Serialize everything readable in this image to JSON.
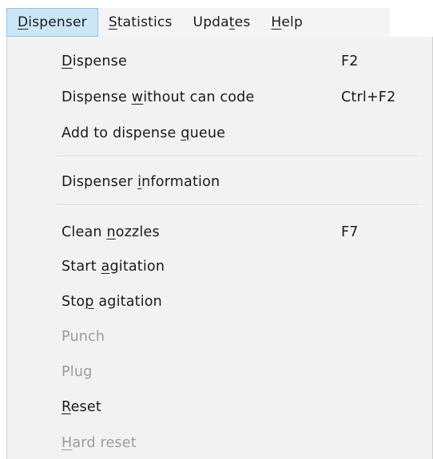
{
  "menubar": {
    "items": [
      {
        "pre": "",
        "mnem": "D",
        "post": "ispenser",
        "active": true
      },
      {
        "pre": "",
        "mnem": "S",
        "post": "tatistics",
        "active": false
      },
      {
        "pre": "Upda",
        "mnem": "t",
        "post": "es",
        "active": false
      },
      {
        "pre": "",
        "mnem": "H",
        "post": "elp",
        "active": false
      }
    ]
  },
  "dropdown": {
    "items": [
      {
        "pre": "",
        "mnem": "D",
        "post": "ispense",
        "shortcut": "F2",
        "disabled": false
      },
      {
        "pre": "Dispense ",
        "mnem": "w",
        "post": "ithout can code",
        "shortcut": "Ctrl+F2",
        "disabled": false
      },
      {
        "pre": "Add to dispense ",
        "mnem": "q",
        "post": "ueue",
        "shortcut": "",
        "disabled": false
      },
      {
        "pre": "Dispenser ",
        "mnem": "i",
        "post": "nformation",
        "shortcut": "",
        "disabled": false
      },
      {
        "pre": "Clean ",
        "mnem": "n",
        "post": "ozzles",
        "shortcut": "F7",
        "disabled": false
      },
      {
        "pre": "Start ",
        "mnem": "a",
        "post": "gitation",
        "shortcut": "",
        "disabled": false
      },
      {
        "pre": "Sto",
        "mnem": "p",
        "post": " agitation",
        "shortcut": "",
        "disabled": false
      },
      {
        "pre": "Punch",
        "mnem": "",
        "post": "",
        "shortcut": "",
        "disabled": true
      },
      {
        "pre": "Plug",
        "mnem": "",
        "post": "",
        "shortcut": "",
        "disabled": true
      },
      {
        "pre": "",
        "mnem": "R",
        "post": "eset",
        "shortcut": "",
        "disabled": false
      },
      {
        "pre": "",
        "mnem": "H",
        "post": "ard reset",
        "shortcut": "",
        "disabled": true
      }
    ]
  }
}
